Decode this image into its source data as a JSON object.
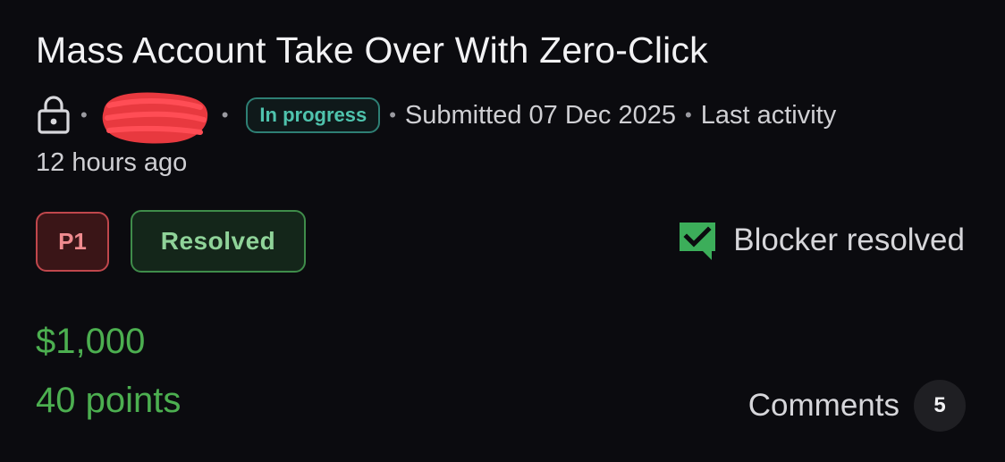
{
  "report": {
    "title": "Mass Account Take Over With Zero-Click",
    "meta": {
      "status": "In progress",
      "separator": "•",
      "submitted": "Submitted 07 Dec 2025",
      "last_activity_label": "Last activity",
      "last_activity_value": "12 hours ago"
    },
    "severity": "P1",
    "state": "Resolved",
    "blocker": {
      "icon": "checkmark-comment-icon",
      "label": "Blocker resolved"
    },
    "bounty": "$1,000",
    "points": "40 points",
    "comments": {
      "label": "Comments",
      "count": "5"
    }
  },
  "colors": {
    "background": "#0b0b0f",
    "status_teal": "#4fc3ad",
    "severity_red": "#c0474c",
    "resolved_green": "#3f8c4a",
    "money_green": "#4caf50",
    "redaction": "#e8393f"
  },
  "icons": {
    "lock": "lock-icon",
    "redaction": "redacted-username-scribble"
  }
}
